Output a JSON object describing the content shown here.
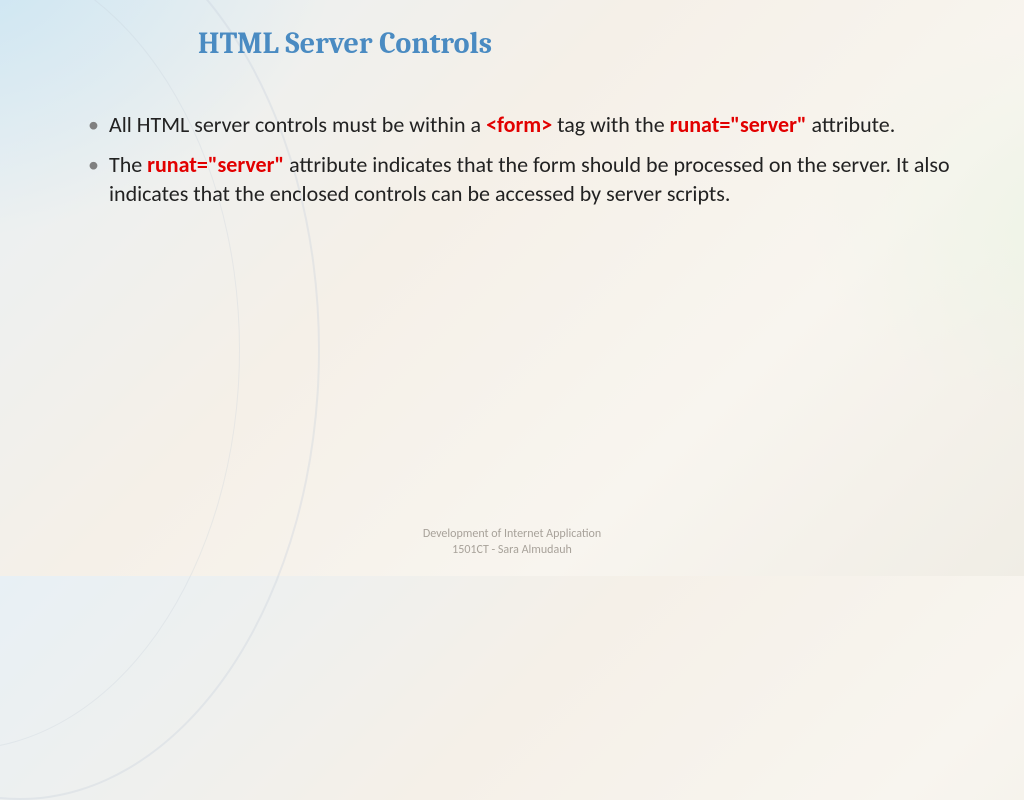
{
  "title": "HTML Server Controls",
  "bullets": [
    {
      "segments": [
        {
          "text": "All HTML server controls must be within a ",
          "highlight": false
        },
        {
          "text": "<form>",
          "highlight": true
        },
        {
          "text": " tag with the ",
          "highlight": false
        },
        {
          "text": "runat=\"server\"",
          "highlight": true
        },
        {
          "text": " attribute.",
          "highlight": false
        }
      ]
    },
    {
      "segments": [
        {
          "text": "The ",
          "highlight": false
        },
        {
          "text": "runat=\"server\"",
          "highlight": true
        },
        {
          "text": " attribute indicates that the form should be processed on the server. It also indicates that the enclosed controls can be accessed by server scripts.",
          "highlight": false
        }
      ]
    }
  ],
  "footer": {
    "line1": "Development of Internet Application",
    "line2": "1501CT - Sara Almudauh"
  },
  "bullet_char": "•"
}
